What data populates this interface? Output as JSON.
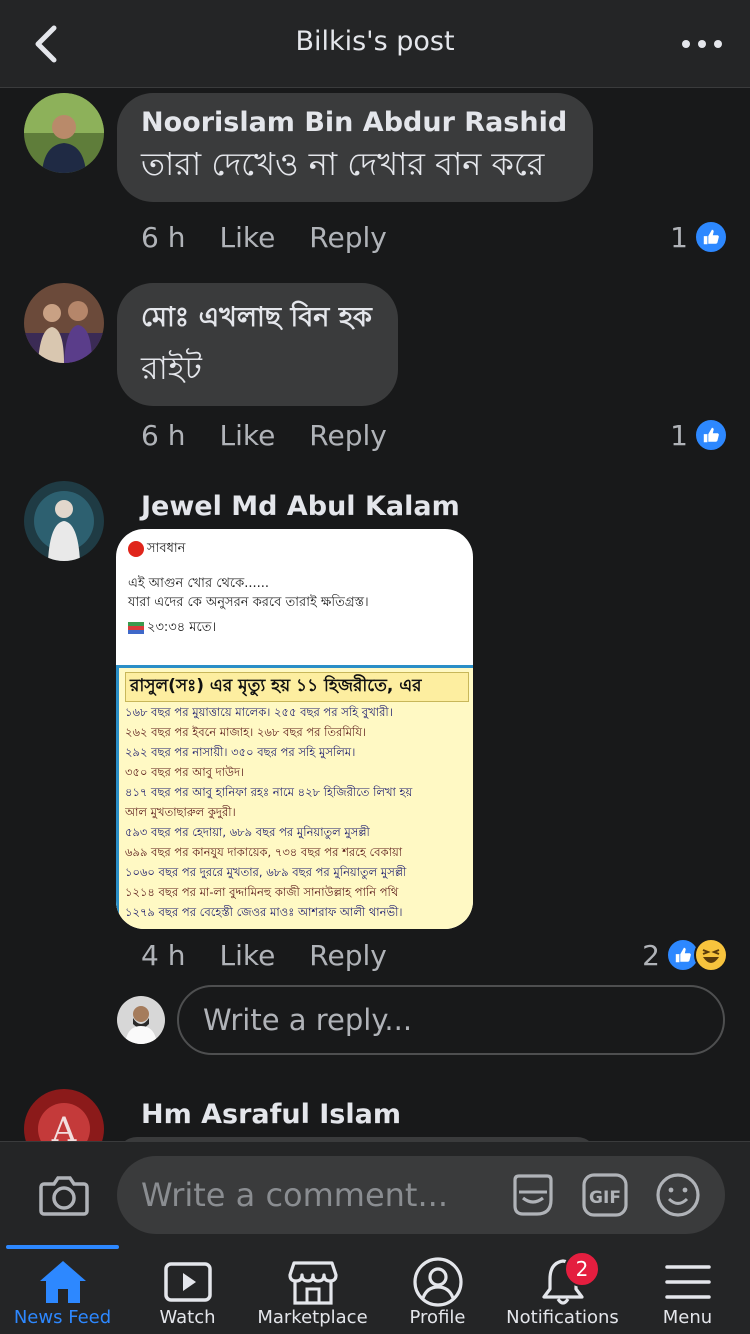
{
  "header": {
    "title": "Bilkis's post"
  },
  "comments": [
    {
      "author": "Noorislam Bin Abdur Rashid",
      "text": "তারা দেখেও না দেখার বান করে",
      "time": "6 h",
      "like_label": "Like",
      "reply_label": "Reply",
      "reaction_count": "1"
    },
    {
      "author": "মোঃ এখলাছ বিন হক",
      "text": "রাইট",
      "time": "6 h",
      "like_label": "Like",
      "reply_label": "Reply",
      "reaction_count": "1"
    },
    {
      "author": "Jewel Md Abul Kalam",
      "time": "4 h",
      "like_label": "Like",
      "reply_label": "Reply",
      "reaction_count": "2",
      "image": {
        "caption_title": "সাবধান",
        "caption_line1": "এই আগুন খোর থেকে......",
        "caption_line2": "যারা এদের কে অনুসরন করবে তারাই ক্ষতিগ্রস্ত।",
        "caption_line3": "২৩:৩৪ মতে।",
        "heading": "রাসুল(সঃ) এর মৃত্যু হয় ১১ হিজরীতে, এর",
        "lines": [
          "১৬৮ বছর পর মুয়াত্তায়ে মালেক। ২৫৫ বছর পর সহি বুখারী।",
          "২৬২ বছর পর ইবনে মাজাহ।    ২৬৮ বছর পর তিরমিযি।",
          "২৯২ বছর পর নাসায়ী।        ৩৫০ বছর পর সহি মুসলিম।",
          "৩৫০ বছর পর আবু দাউদ।",
          "৪১৭ বছর পর আবু হানিফা রহঃ নামে ৪২৮ হিজিরীতে লিখা হয়",
          "আল মুখতাছারুল কুদুরী।",
          "৫৯৩ বছর পর হেদায়া,       ৬৮৯ বছর পর মুনিয়াতুল মুসল্লী",
          "৬৯৯ বছর পর কানযুয দাকায়েক, ৭৩৪ বছর পর শরহে বেকায়া",
          "১০৬০ বছর পর দুররে মুখতার, ৬৮৯ বছর পর মুনিয়াতুল মুসল্লী",
          "১২১৪ বছর পর মা-লা বুদ্দামিনহু কাজী সানাউল্লাহ পানি পথি",
          "১২৭৯ বছর পর বেহেস্তী জেওর মাওঃ আশরাফ আলী থানভী।"
        ]
      }
    },
    {
      "author": "Hm Asraful Islam"
    }
  ],
  "reply_box": {
    "placeholder": "Write a reply..."
  },
  "composer": {
    "placeholder": "Write a comment..."
  },
  "nav": {
    "tabs": [
      {
        "label": "News Feed",
        "icon": "home-icon"
      },
      {
        "label": "Watch",
        "icon": "video-icon"
      },
      {
        "label": "Marketplace",
        "icon": "store-icon"
      },
      {
        "label": "Profile",
        "icon": "profile-icon"
      },
      {
        "label": "Notifications",
        "icon": "bell-icon",
        "badge": "2"
      },
      {
        "label": "Menu",
        "icon": "hamburger-icon"
      }
    ]
  },
  "colors": {
    "accent": "#2d88ff",
    "badge": "#e41e3f",
    "bubble": "#3a3b3c",
    "background": "#18191a"
  }
}
